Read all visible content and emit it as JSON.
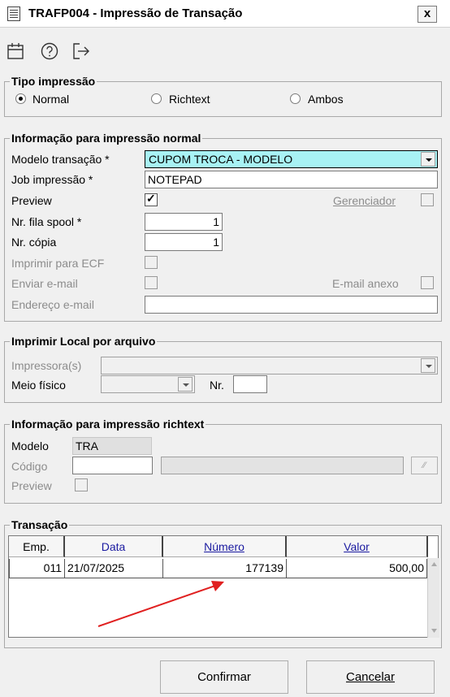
{
  "window": {
    "title": "TRAFP004 - Impressão de Transação",
    "close_label": "x"
  },
  "toolbar": {
    "icons": [
      "calendar-icon",
      "help-icon",
      "exit-icon"
    ]
  },
  "tipo_impressao": {
    "legend": "Tipo impressão",
    "options": [
      "Normal",
      "Richtext",
      "Ambos"
    ],
    "selected": "Normal"
  },
  "normal": {
    "legend": "Informação para impressão normal",
    "modelo_label": "Modelo transação *",
    "modelo_value": "CUPOM TROCA - MODELO",
    "job_label": "Job impressão *",
    "job_value": "NOTEPAD",
    "preview_label": "Preview",
    "preview_checked": true,
    "gerenciador_label": "Gerenciador",
    "gerenciador_checked": false,
    "fila_label": "Nr. fila spool *",
    "fila_value": "1",
    "copia_label": "Nr. cópia",
    "copia_value": "1",
    "ecf_label": "Imprimir para ECF",
    "email_label": "Enviar e-mail",
    "anexo_label": "E-mail anexo",
    "endereco_label": "Endereço e-mail",
    "endereco_value": ""
  },
  "local": {
    "legend": "Imprimir Local por arquivo",
    "impressora_label": "Impressora(s)",
    "meio_label": "Meio físico",
    "nr_label": "Nr."
  },
  "richtext": {
    "legend": "Informação para impressão richtext",
    "modelo_label": "Modelo",
    "modelo_value": "TRA",
    "codigo_label": "Código",
    "preview_label": "Preview"
  },
  "transacao": {
    "legend": "Transação",
    "columns": [
      "Emp.",
      "Data",
      "Número",
      "Valor"
    ],
    "rows": [
      {
        "emp": "011",
        "data": "21/07/2025",
        "numero": "177139",
        "valor": "500,00"
      }
    ]
  },
  "buttons": {
    "confirmar": "Confirmar",
    "cancelar": "Cancelar"
  },
  "colors": {
    "modelo_highlight": "#a8f2f4",
    "arrow": "#e02020"
  }
}
